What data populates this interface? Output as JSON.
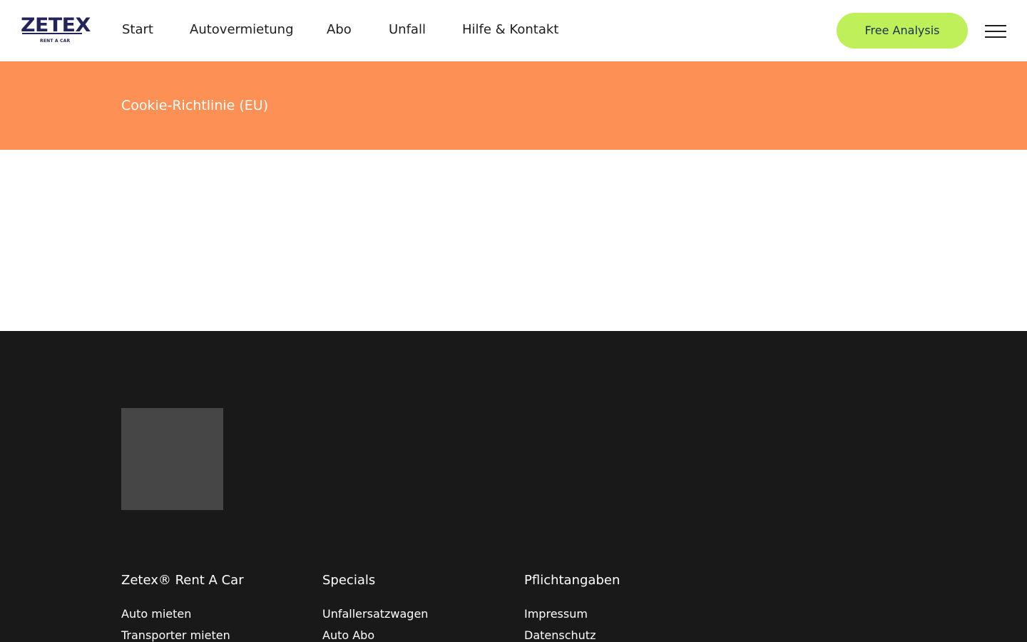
{
  "header": {
    "logo_text": "ZETEX",
    "logo_subtext": "RENT A CAR",
    "nav": [
      {
        "label": "Start"
      },
      {
        "label": "Autovermietung"
      },
      {
        "label": "Abo"
      },
      {
        "label": "Unfall"
      },
      {
        "label": "Hilfe & Kontakt"
      }
    ],
    "cta_label": "Free Analysis",
    "menu_icon": "hamburger-menu-icon"
  },
  "banner": {
    "title": "Cookie-Richtlinie (EU)"
  },
  "footer": {
    "columns": [
      {
        "heading": "Zetex® Rent A Car",
        "links": [
          "Auto mieten",
          "Transporter mieten"
        ]
      },
      {
        "heading": "Specials",
        "links": [
          "Unfallersatzwagen",
          "Auto Abo"
        ]
      },
      {
        "heading": "Pflichtangaben",
        "links": [
          "Impressum",
          "Datenschutz"
        ]
      }
    ]
  },
  "colors": {
    "brand_navy": "#23245a",
    "banner_orange": "#fd9055",
    "cta_green": "#bff05a",
    "footer_bg": "#19191a",
    "placeholder_gray": "#464646"
  }
}
